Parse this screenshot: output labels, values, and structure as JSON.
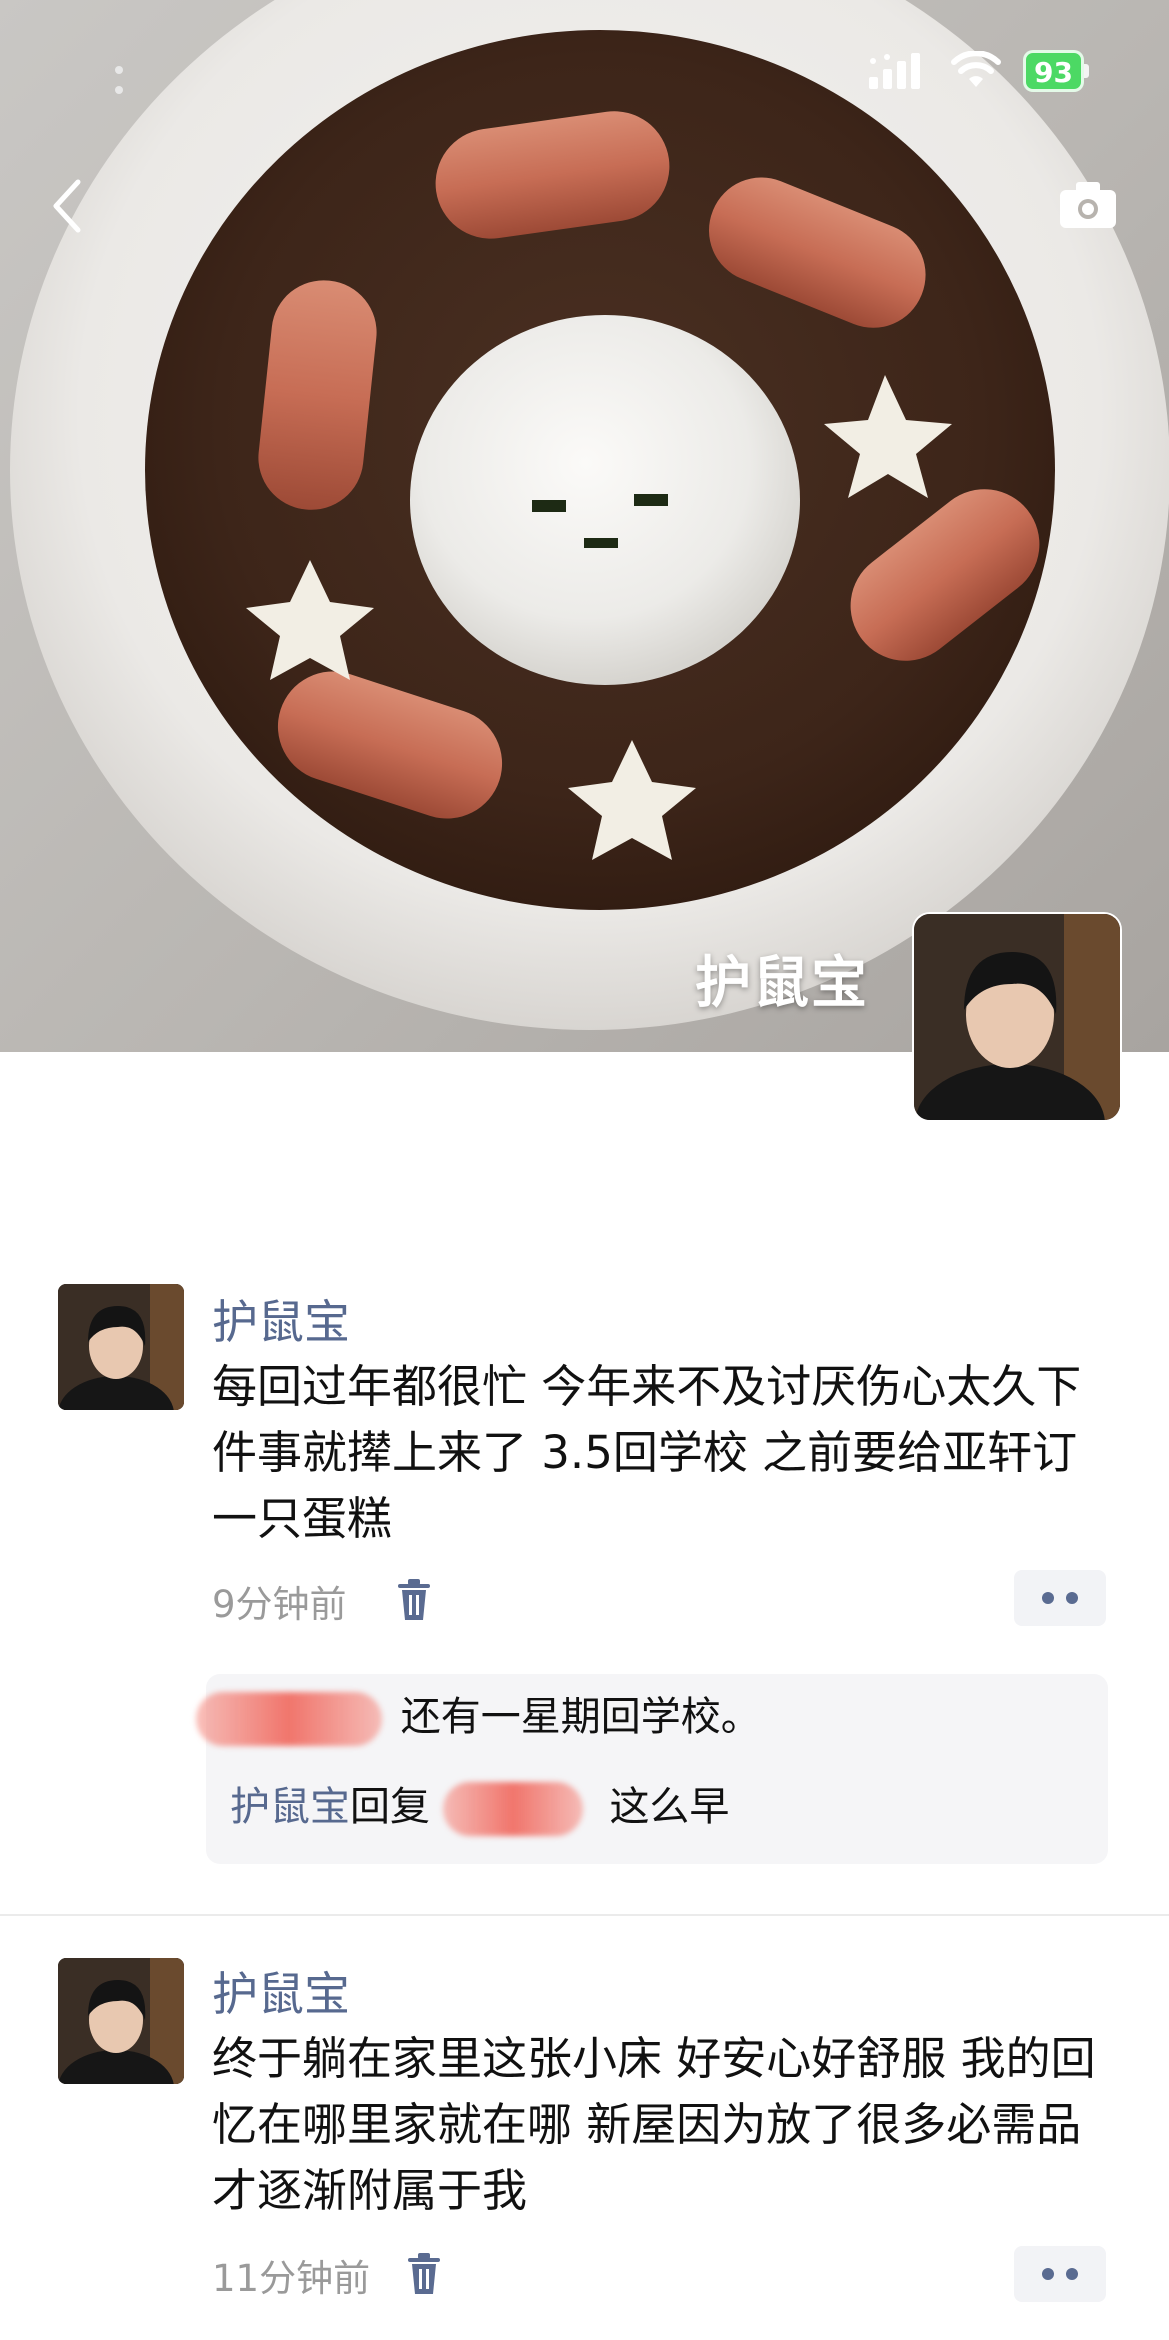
{
  "status_bar": {
    "battery": "93"
  },
  "cover": {
    "owner_name": "护鼠宝"
  },
  "posts": [
    {
      "name": "护鼠宝",
      "text": "每回过年都很忙 今年来不及讨厌伤心太久下件事就撵上来了 3.5回学校 之前要给亚轩订一只蛋糕",
      "time": "9分钟前"
    },
    {
      "name": "护鼠宝",
      "text": "终于躺在家里这张小床 好安心好舒服 我的回忆在哪里家就在哪 新屋因为放了很多必需品才逐渐附属于我",
      "time": "11分钟前"
    }
  ],
  "comments": [
    {
      "text": "还有一星期回学校。"
    },
    {
      "author": "护鼠宝",
      "reply_word": "回复",
      "text": "这么早"
    }
  ],
  "icons": {
    "back": "chevron-left-icon",
    "camera": "camera-icon",
    "trash": "trash-icon",
    "more": "more-dots-icon",
    "signal": "signal-icon",
    "wifi": "wifi-icon"
  },
  "colors": {
    "name_blue": "#57698f",
    "battery_green": "#4cd964",
    "comment_bg": "#f5f5f7"
  }
}
